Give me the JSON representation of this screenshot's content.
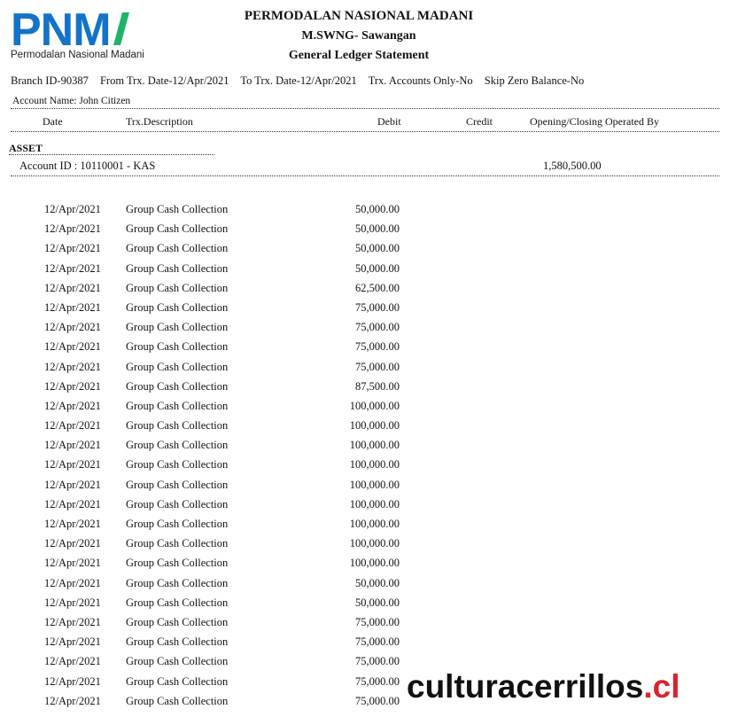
{
  "logo": {
    "text": "PNM",
    "subtitle": "Permodalan Nasional Madani",
    "color": "#1473c9",
    "accent": "#1fb36a"
  },
  "header": {
    "company": "PERMODALAN NASIONAL MADANI",
    "branch": "M.SWNG- Sawangan",
    "report_title": "General Ledger Statement"
  },
  "params": {
    "branch_id": "Branch ID-90387",
    "from_date": "From Trx. Date-12/Apr/2021",
    "to_date": "To Trx. Date-12/Apr/2021",
    "trx_accounts": "Trx. Accounts Only-No",
    "skip_zero": "Skip Zero Balance-No"
  },
  "account_name": "Account Name: John Citizen",
  "columns": {
    "date": "Date",
    "description": "Trx.Description",
    "debit": "Debit",
    "credit": "Credit",
    "opening_closing": "Opening/Closing Operated By"
  },
  "section": "ASSET",
  "account": {
    "id_label": "Account ID : 10110001   -   KAS",
    "opening_balance": "1,580,500.00"
  },
  "rows": [
    {
      "date": "12/Apr/2021",
      "desc": "Group Cash Collection",
      "debit": "50,000.00"
    },
    {
      "date": "12/Apr/2021",
      "desc": "Group Cash Collection",
      "debit": "50,000.00"
    },
    {
      "date": "12/Apr/2021",
      "desc": "Group Cash Collection",
      "debit": "50,000.00"
    },
    {
      "date": "12/Apr/2021",
      "desc": "Group Cash Collection",
      "debit": "50,000.00"
    },
    {
      "date": "12/Apr/2021",
      "desc": "Group Cash Collection",
      "debit": "62,500.00"
    },
    {
      "date": "12/Apr/2021",
      "desc": "Group Cash Collection",
      "debit": "75,000.00"
    },
    {
      "date": "12/Apr/2021",
      "desc": "Group Cash Collection",
      "debit": "75,000.00"
    },
    {
      "date": "12/Apr/2021",
      "desc": "Group Cash Collection",
      "debit": "75,000.00"
    },
    {
      "date": "12/Apr/2021",
      "desc": "Group Cash Collection",
      "debit": "75,000.00"
    },
    {
      "date": "12/Apr/2021",
      "desc": "Group Cash Collection",
      "debit": "87,500.00"
    },
    {
      "date": "12/Apr/2021",
      "desc": "Group Cash Collection",
      "debit": "100,000.00"
    },
    {
      "date": "12/Apr/2021",
      "desc": "Group Cash Collection",
      "debit": "100,000.00"
    },
    {
      "date": "12/Apr/2021",
      "desc": "Group Cash Collection",
      "debit": "100,000.00"
    },
    {
      "date": "12/Apr/2021",
      "desc": "Group Cash Collection",
      "debit": "100,000.00"
    },
    {
      "date": "12/Apr/2021",
      "desc": "Group Cash Collection",
      "debit": "100,000.00"
    },
    {
      "date": "12/Apr/2021",
      "desc": "Group Cash Collection",
      "debit": "100,000.00"
    },
    {
      "date": "12/Apr/2021",
      "desc": "Group Cash Collection",
      "debit": "100,000.00"
    },
    {
      "date": "12/Apr/2021",
      "desc": "Group Cash Collection",
      "debit": "100,000.00"
    },
    {
      "date": "12/Apr/2021",
      "desc": "Group Cash Collection",
      "debit": "100,000.00"
    },
    {
      "date": "12/Apr/2021",
      "desc": "Group Cash Collection",
      "debit": "50,000.00"
    },
    {
      "date": "12/Apr/2021",
      "desc": "Group Cash Collection",
      "debit": "50,000.00"
    },
    {
      "date": "12/Apr/2021",
      "desc": "Group Cash Collection",
      "debit": "75,000.00"
    },
    {
      "date": "12/Apr/2021",
      "desc": "Group Cash Collection",
      "debit": "75,000.00"
    },
    {
      "date": "12/Apr/2021",
      "desc": "Group Cash Collection",
      "debit": "75,000.00"
    },
    {
      "date": "12/Apr/2021",
      "desc": "Group Cash Collection",
      "debit": "75,000.00"
    },
    {
      "date": "12/Apr/2021",
      "desc": "Group Cash Collection",
      "debit": "75,000.00"
    }
  ],
  "watermark": {
    "name": "culturacerrillos",
    "dot": ".",
    "tld": "cl"
  }
}
